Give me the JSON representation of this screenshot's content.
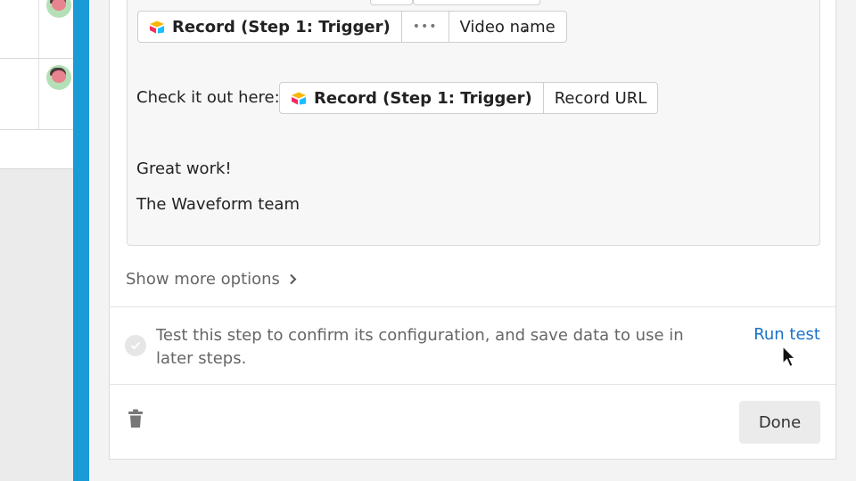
{
  "message": {
    "line_pre": "",
    "line_check": "Check it out here:",
    "line_great": "Great work!",
    "line_team": "The Waveform team",
    "period": "."
  },
  "pill_video": {
    "source": "Record (Step 1: Trigger)",
    "more": "•••",
    "field": "Video name"
  },
  "pill_url": {
    "source": "Record (Step 1: Trigger)",
    "field": "Record URL"
  },
  "options": {
    "show_more_label": "Show more options"
  },
  "test": {
    "description": "Test this step to confirm its configuration, and save data to use in later steps.",
    "run_label": "Run test"
  },
  "footer": {
    "done_label": "Done"
  },
  "icons": {
    "source_icon": "airtable-logo-icon",
    "chevron": "chevron-right-icon",
    "check": "check-circle-icon",
    "trash": "trash-icon",
    "cursor": "mouse-pointer-icon"
  },
  "colors": {
    "accent_blue_bar": "#189bd7",
    "link": "#1a73c8",
    "done_bg": "#ebebeb"
  }
}
